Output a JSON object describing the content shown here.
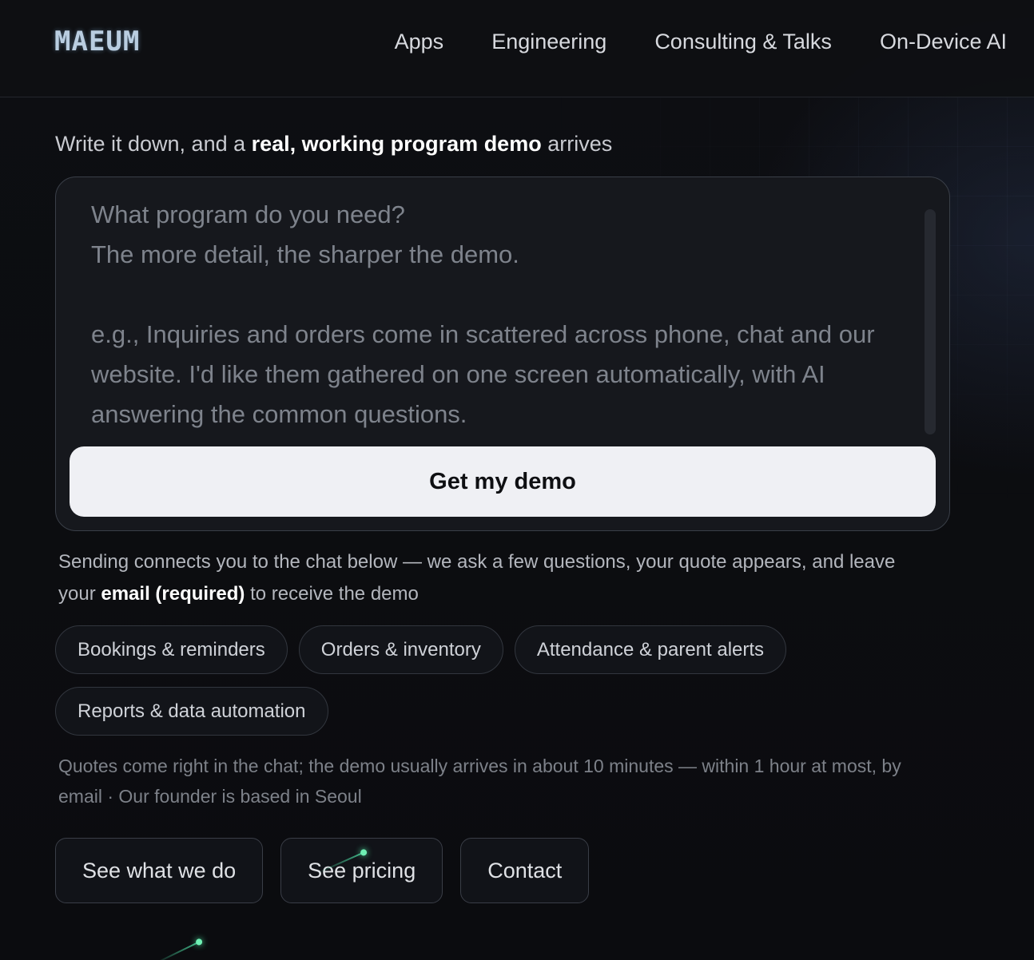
{
  "header": {
    "logo": "MAEUM",
    "nav": [
      "Apps",
      "Engineering",
      "Consulting & Talks",
      "On-Device AI"
    ]
  },
  "hero": {
    "tagline_pre": "Write it down, and a ",
    "tagline_bold": "real, working program demo",
    "tagline_post": " arrives"
  },
  "composer": {
    "placeholder": "What program do you need?\nThe more detail, the sharper the demo.\n\ne.g., Inquiries and orders come in scattered across phone, chat and our website. I'd like them gathered on one screen automatically, with AI answering the common questions.",
    "submit_label": "Get my demo"
  },
  "note": {
    "pre": "Sending connects you to the chat below — we ask a few questions, your quote appears, and leave your ",
    "bold": "email (required)",
    "post": " to receive the demo"
  },
  "chips": [
    "Bookings & reminders",
    "Orders & inventory",
    "Attendance & parent alerts",
    "Reports & data automation"
  ],
  "fineprint": "Quotes come right in the chat; the demo usually arrives in about 10 minutes — within 1 hour at most, by email · Our founder is based in Seoul",
  "actions": [
    "See what we do",
    "See pricing",
    "Contact"
  ],
  "colors": {
    "background": "#0c0d10",
    "accent_meteor": "#6ff0b4",
    "button_light": "#eff0f4"
  }
}
